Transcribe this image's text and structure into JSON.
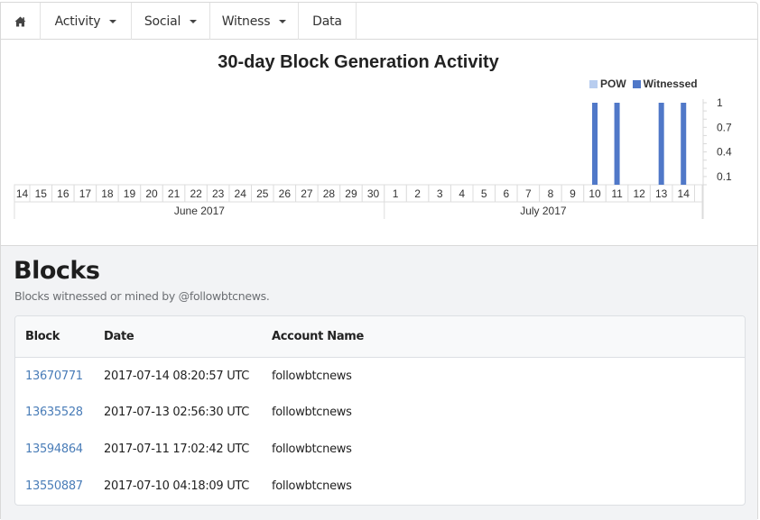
{
  "nav": {
    "home_icon": "home-icon",
    "items": [
      {
        "label": "Activity",
        "has_dropdown": true
      },
      {
        "label": "Social",
        "has_dropdown": true
      },
      {
        "label": "Witness",
        "has_dropdown": true
      },
      {
        "label": "Data",
        "has_dropdown": false
      }
    ]
  },
  "colors": {
    "pow": "#b8cdef",
    "witnessed": "#5078c8",
    "link": "#4a7db8",
    "section_bg": "#f2f3f5"
  },
  "chart_data": {
    "type": "bar",
    "title": "30-day Block Generation Activity",
    "legend": [
      "POW",
      "Witnessed"
    ],
    "legend_position": "top-right",
    "x_groups": [
      {
        "label": "June 2017",
        "days": [
          "14",
          "15",
          "16",
          "17",
          "18",
          "19",
          "20",
          "21",
          "22",
          "23",
          "24",
          "25",
          "26",
          "27",
          "28",
          "29",
          "30"
        ]
      },
      {
        "label": "July 2017",
        "days": [
          "1",
          "2",
          "3",
          "4",
          "5",
          "6",
          "7",
          "8",
          "9",
          "10",
          "11",
          "12",
          "13",
          "14"
        ]
      }
    ],
    "categories": [
      "Jun 14",
      "Jun 15",
      "Jun 16",
      "Jun 17",
      "Jun 18",
      "Jun 19",
      "Jun 20",
      "Jun 21",
      "Jun 22",
      "Jun 23",
      "Jun 24",
      "Jun 25",
      "Jun 26",
      "Jun 27",
      "Jun 28",
      "Jun 29",
      "Jun 30",
      "Jul 1",
      "Jul 2",
      "Jul 3",
      "Jul 4",
      "Jul 5",
      "Jul 6",
      "Jul 7",
      "Jul 8",
      "Jul 9",
      "Jul 10",
      "Jul 11",
      "Jul 12",
      "Jul 13",
      "Jul 14"
    ],
    "series": [
      {
        "name": "POW",
        "values": [
          0,
          0,
          0,
          0,
          0,
          0,
          0,
          0,
          0,
          0,
          0,
          0,
          0,
          0,
          0,
          0,
          0,
          0,
          0,
          0,
          0,
          0,
          0,
          0,
          0,
          0,
          0,
          0,
          0,
          0,
          0
        ]
      },
      {
        "name": "Witnessed",
        "values": [
          0,
          0,
          0,
          0,
          0,
          0,
          0,
          0,
          0,
          0,
          0,
          0,
          0,
          0,
          0,
          0,
          0,
          0,
          0,
          0,
          0,
          0,
          0,
          0,
          0,
          0,
          1,
          1,
          0,
          1,
          1
        ]
      }
    ],
    "y_ticks": [
      "1",
      "0.7",
      "0.4",
      "0.1"
    ],
    "y_tick_values": [
      1,
      0.7,
      0.4,
      0.1
    ],
    "ylim": [
      0,
      1
    ],
    "y_axis_side": "right",
    "xlabel": "",
    "ylabel": ""
  },
  "blocks": {
    "title": "Blocks",
    "subtitle": "Blocks witnessed or mined by @followbtcnews.",
    "columns": [
      "Block",
      "Date",
      "Account Name"
    ],
    "rows": [
      {
        "block": "13670771",
        "date": "2017-07-14 08:20:57 UTC",
        "account": "followbtcnews"
      },
      {
        "block": "13635528",
        "date": "2017-07-13 02:56:30 UTC",
        "account": "followbtcnews"
      },
      {
        "block": "13594864",
        "date": "2017-07-11 17:02:42 UTC",
        "account": "followbtcnews"
      },
      {
        "block": "13550887",
        "date": "2017-07-10 04:18:09 UTC",
        "account": "followbtcnews"
      }
    ]
  }
}
